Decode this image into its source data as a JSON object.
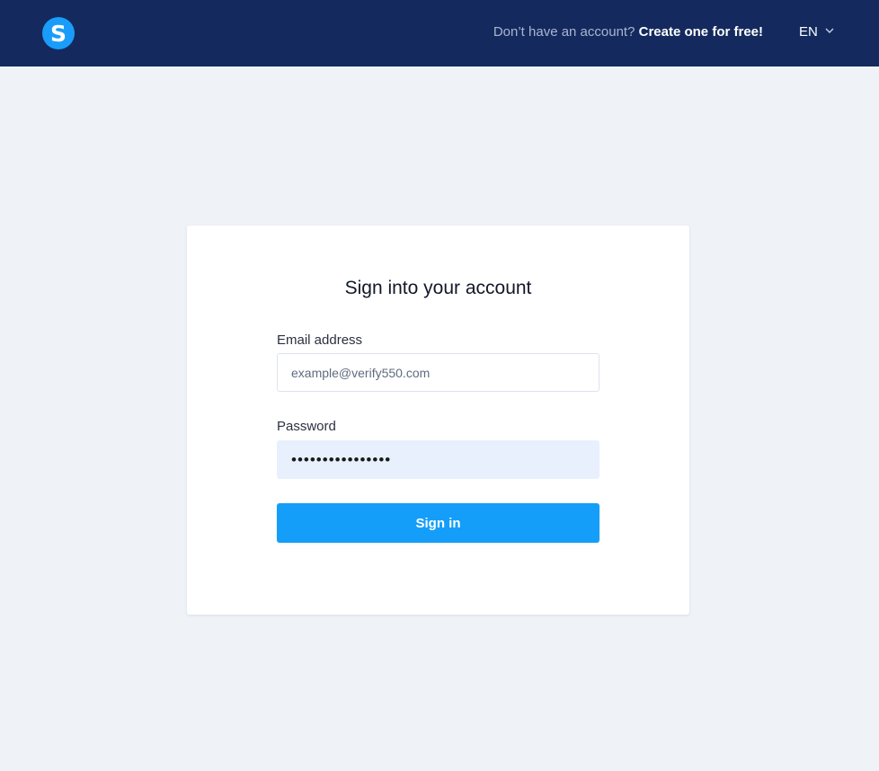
{
  "header": {
    "logo_letter": "S",
    "signup_prompt": "Don’t have an account?",
    "signup_link": "Create one for free!",
    "language": "EN",
    "language_icon": "chevron-down-icon"
  },
  "form": {
    "title": "Sign into your account",
    "email_label": "Email address",
    "email_placeholder": "example@verify550.com",
    "email_value": "",
    "password_label": "Password",
    "password_value": "••••••••••••••••",
    "submit_label": "Sign in"
  },
  "colors": {
    "topbar": "#142a5e",
    "accent": "#159ef9",
    "background": "#eff3f8",
    "password_fill": "#e8f0fd"
  }
}
